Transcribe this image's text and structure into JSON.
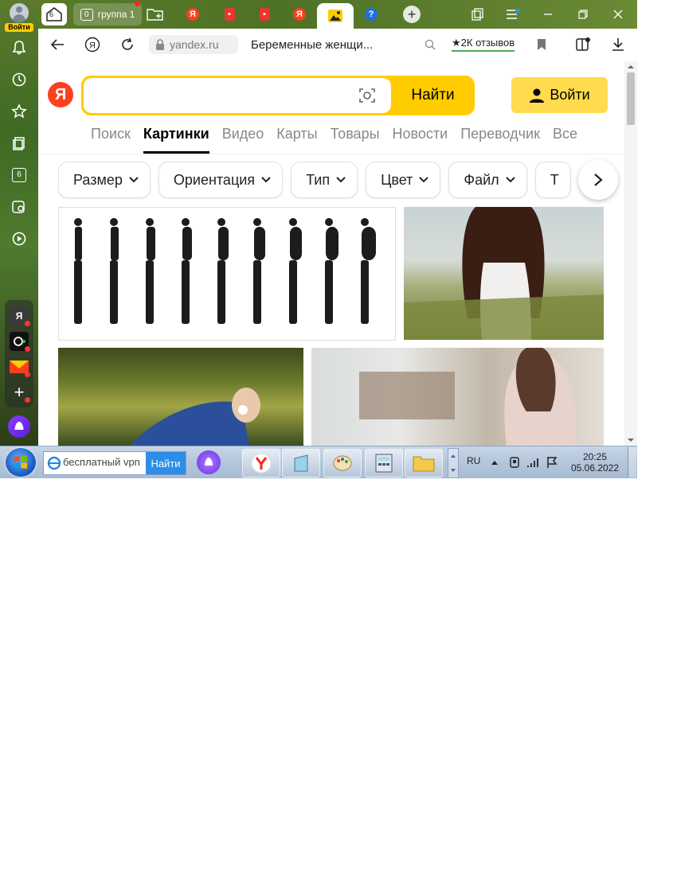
{
  "sidebar": {
    "login_label": "Войти",
    "badge_count": "6",
    "app_yandex": "Я"
  },
  "tabs": {
    "home_count": "6",
    "group_count": "0",
    "group_label": "группа 1"
  },
  "addressbar": {
    "domain": "yandex.ru",
    "title": "Беременные женщи...",
    "reviews": "★2К отзывов"
  },
  "search": {
    "logo": "Я",
    "query": "",
    "button": "Найти",
    "login": "Войти"
  },
  "service_tabs": [
    "Поиск",
    "Картинки",
    "Видео",
    "Карты",
    "Товары",
    "Новости",
    "Переводчик",
    "Все"
  ],
  "active_service_tab": "Картинки",
  "filters": [
    "Размер",
    "Ориентация",
    "Тип",
    "Цвет",
    "Файл",
    "Т"
  ],
  "taskbar": {
    "ie_query": "бесплатный vpn",
    "ie_go": "Найти",
    "lang": "RU",
    "time": "20:25",
    "date": "05.06.2022"
  },
  "colors": {
    "accent_yellow": "#ffcc00",
    "yandex_red": "#fc3f1d",
    "alice_purple": "#7b2fff"
  }
}
